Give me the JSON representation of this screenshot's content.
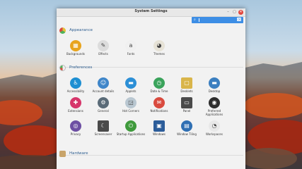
{
  "window": {
    "title": "System Settings",
    "controls": {
      "minimize": "–",
      "maximize": "▢",
      "close": "✕"
    }
  },
  "search": {
    "icon": "search-icon",
    "value": "",
    "clear": "⌫"
  },
  "sections": {
    "appearance": {
      "title": "Appearance",
      "items": [
        {
          "label": "Backgrounds",
          "glyph": "▦",
          "color": "#e8a41d"
        },
        {
          "label": "Effects",
          "glyph": "✎",
          "color": "#dcdcdc"
        },
        {
          "label": "Fonts",
          "glyph": "a",
          "color": "#f0f0f0"
        },
        {
          "label": "Themes",
          "glyph": "◕",
          "color": "#e6e2d6"
        }
      ]
    },
    "preferences": {
      "title": "Preferences",
      "items": [
        {
          "label": "Accessibility",
          "glyph": "♿",
          "color": "#1e8fd2"
        },
        {
          "label": "Account details",
          "glyph": "☺",
          "color": "#3f86c9"
        },
        {
          "label": "Applets",
          "glyph": "▬",
          "color": "#2c8fd6"
        },
        {
          "label": "Date & Time",
          "glyph": "◷",
          "color": "#3aa35b"
        },
        {
          "label": "Desklets",
          "glyph": "▢",
          "color": "#d9b54a"
        },
        {
          "label": "Desktop",
          "glyph": "▬",
          "color": "#3b7fc0"
        },
        {
          "label": "Extensions",
          "glyph": "✚",
          "color": "#d6366b"
        },
        {
          "label": "General",
          "glyph": "⚙",
          "color": "#5a6b78"
        },
        {
          "label": "Hot Corners",
          "glyph": "◲",
          "color": "#b9c7d1"
        },
        {
          "label": "Notifications",
          "glyph": "✉",
          "color": "#d94b3f"
        },
        {
          "label": "Panel",
          "glyph": "▭",
          "color": "#4a4a4a"
        },
        {
          "label": "Preferred Applications",
          "glyph": "◉",
          "color": "#2d2d2d"
        },
        {
          "label": "Privacy",
          "glyph": "◎",
          "color": "#6d4fa3"
        },
        {
          "label": "Screensaver",
          "glyph": "☾",
          "color": "#4a4a4a"
        },
        {
          "label": "Startup Applications",
          "glyph": "⏻",
          "color": "#3f9a3c"
        },
        {
          "label": "Windows",
          "glyph": "▣",
          "color": "#2c5d9a"
        },
        {
          "label": "Window Tiling",
          "glyph": "▤",
          "color": "#2f6fb3"
        },
        {
          "label": "Workspaces",
          "glyph": "◔",
          "color": "#e8e8e8"
        }
      ]
    },
    "hardware": {
      "title": "Hardware"
    }
  },
  "colors": {
    "accent": "#3d8ee5",
    "section_title": "#2f5f91",
    "close": "#e2453c"
  }
}
